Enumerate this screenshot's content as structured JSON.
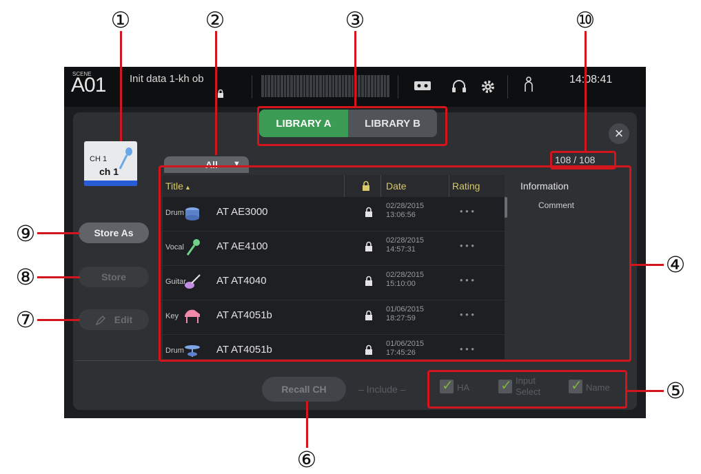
{
  "callouts": [
    "①",
    "②",
    "③",
    "④",
    "⑤",
    "⑥",
    "⑦",
    "⑧",
    "⑨",
    "⑩"
  ],
  "topbar": {
    "scene_label": "SCENE",
    "scene_number": "A01",
    "scene_name": "Init data 1-kh ob",
    "time": "14:08:41"
  },
  "library_tabs": [
    {
      "label": "LIBRARY A",
      "active": true
    },
    {
      "label": "LIBRARY B",
      "active": false
    }
  ],
  "close_label": "×",
  "counter": "108 / 108",
  "channel": {
    "number": "CH 1",
    "name": "ch 1",
    "icon": "mic-icon",
    "color": "#2a5bd7"
  },
  "category_filter": {
    "value": "All"
  },
  "side_buttons": {
    "store_as": "Store As",
    "store": "Store",
    "edit": "Edit"
  },
  "table": {
    "headers": {
      "title": "Title",
      "lock_icon": "lock-icon",
      "date": "Date",
      "rating": "Rating",
      "information": "Information"
    },
    "sort_indicator": "▲",
    "information_comment": "Comment",
    "rows": [
      {
        "category": "Drum",
        "icon": "drum-icon",
        "title": "AT AE3000",
        "date1": "02/28/2015",
        "date2": "13:06:56",
        "rating": "• • •"
      },
      {
        "category": "Vocal",
        "icon": "mic-icon",
        "title": "AT AE4100",
        "date1": "02/28/2015",
        "date2": "14:57:31",
        "rating": "• • •"
      },
      {
        "category": "Guitar",
        "icon": "guitar-icon",
        "title": "AT AT4040",
        "date1": "02/28/2015",
        "date2": "15:10:00",
        "rating": "• • •"
      },
      {
        "category": "Key",
        "icon": "piano-icon",
        "title": "AT AT4051b",
        "date1": "01/06/2015",
        "date2": "18:27:59",
        "rating": "• • •"
      },
      {
        "category": "Drum",
        "icon": "cymbal-icon",
        "title": "AT AT4051b",
        "date1": "01/06/2015",
        "date2": "17:45:26",
        "rating": "• • •"
      }
    ]
  },
  "recall": {
    "button": "Recall CH",
    "include_label": "– Include –"
  },
  "include_options": [
    {
      "label1": "HA",
      "label2": "",
      "checked": true
    },
    {
      "label1": "Input",
      "label2": "Select",
      "checked": true
    },
    {
      "label1": "Name",
      "label2": "",
      "checked": true
    }
  ],
  "colors": {
    "accent_green": "#3c9b54",
    "callout_red": "#d4151c",
    "header_gold": "#d8c96a"
  }
}
